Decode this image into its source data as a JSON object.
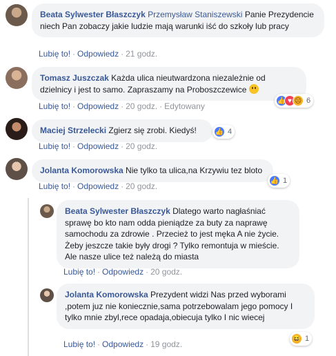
{
  "labels": {
    "like": "Lubię to!",
    "reply": "Odpowiedz",
    "sep": "·"
  },
  "comments": [
    {
      "author": "Beata Sylwester Błaszczyk",
      "tag": "Przemysław Staniszewski",
      "text": " Panie Prezydencie niech Pan zobaczy jakie ludzie mają warunki iść do szkoły lub pracy",
      "time": "21 godz."
    },
    {
      "author": "Tomasz Juszczak",
      "text": " Każda ulica nieutwardzona niezależnie od dzielnicy i jest to samo. Zapraszamy na Proboszczewice ",
      "time": "20 godz.",
      "edited": "Edytowany",
      "reaction_count": "6"
    },
    {
      "author": "Maciej Strzelecki",
      "text": " Zgierz się zrobi. Kiedyś!",
      "time": "20 godz.",
      "reaction_count": "4"
    },
    {
      "author": "Jolanta Komorowska",
      "text": " Nie tylko ta ulica,na Krzywiu tez bloto",
      "time": "20 godz.",
      "reaction_count": "1"
    }
  ],
  "replies": [
    {
      "author": "Beata Sylwester Błaszczyk",
      "text": " Dlatego warto nagłaśniać sprawę bo kto nam odda pieniądze za buty za naprawę samochodu za zdrowie . Przecież to jest męka A nie życie. Żeby jeszcze takie były drogi ? Tylko remontuja w mieście. Ale nasze ulice też należą do miasta",
      "time": "20 godz."
    },
    {
      "author": "Jolanta Komorowska",
      "text": " Prezydent widzi Nas przed wyborami ,potem juz nie koniecznie,sama potrzebowalam jego pomocy I tylko mnie zbyl,rece opadaja,obiecuja tylko I nic wiecej",
      "time": "19 godz.",
      "reaction_count": "1"
    }
  ],
  "colors": {
    "link": "#385898",
    "bubble": "#f2f3f5",
    "meta": "#606770",
    "like_blue": "#4a7aff"
  }
}
